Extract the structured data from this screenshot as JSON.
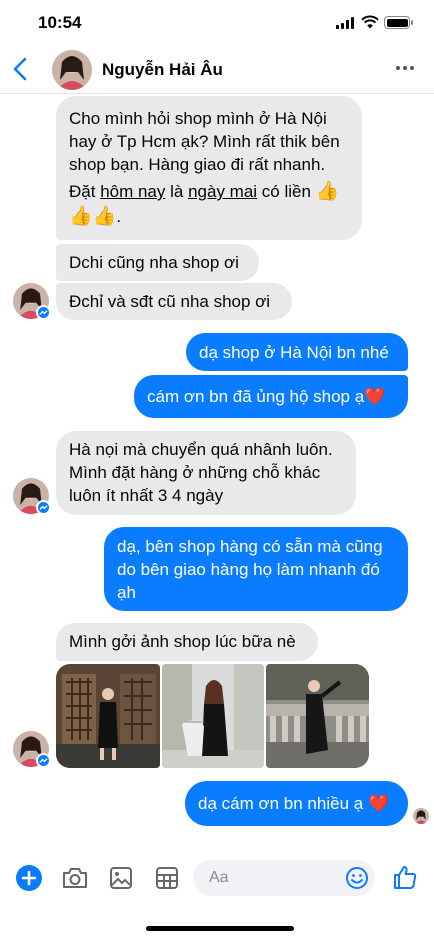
{
  "status_bar": {
    "time": "10:54"
  },
  "header": {
    "contact_name": "Nguyễn Hải Âu"
  },
  "messages": {
    "m1": {
      "line1": "Cho mình hỏi shop mình ở Hà Nội",
      "line2": "hay ở Tp Hcm ạk? Mình rất thik bên",
      "line3": "shop bạn. Hàng giao đi rất nhanh.",
      "line4_a": "Đặt ",
      "line4_b": "hôm nay",
      "line4_c": " là ",
      "line4_d": "ngày mai",
      "line4_e": " có liền ",
      "line5_end": "."
    },
    "m2": "Dchi cũng nha shop ơi",
    "m3": "Đchỉ và sđt cũ nha shop ơi",
    "m4": "dạ shop ở Hà Nội bn nhé",
    "m5": "cám ơn bn đã ủng hộ shop ạ",
    "m6": {
      "line1": "Hà nọi mà chuyển quá nhânh luôn.",
      "line2": "Mình đặt hàng ở những chỗ khác",
      "line3": "luôn ít nhất 3 4 ngày"
    },
    "m7": {
      "line1": "dạ, bên shop hàng có sẵn mà cũng",
      "line2": "do bên giao hàng họ làm nhanh đó",
      "line3": "ạh"
    },
    "m8": "Mình gởi ảnh shop lúc bữa nè",
    "m9": "dạ cám ơn bn nhiều ạ"
  },
  "emoji": {
    "thumbs_up": "👍",
    "heart": "❤️"
  },
  "composer": {
    "placeholder": "Aa"
  },
  "colors": {
    "outgoing": "#0a7cff",
    "incoming": "#e9e9eb",
    "accent": "#0a7cff"
  }
}
